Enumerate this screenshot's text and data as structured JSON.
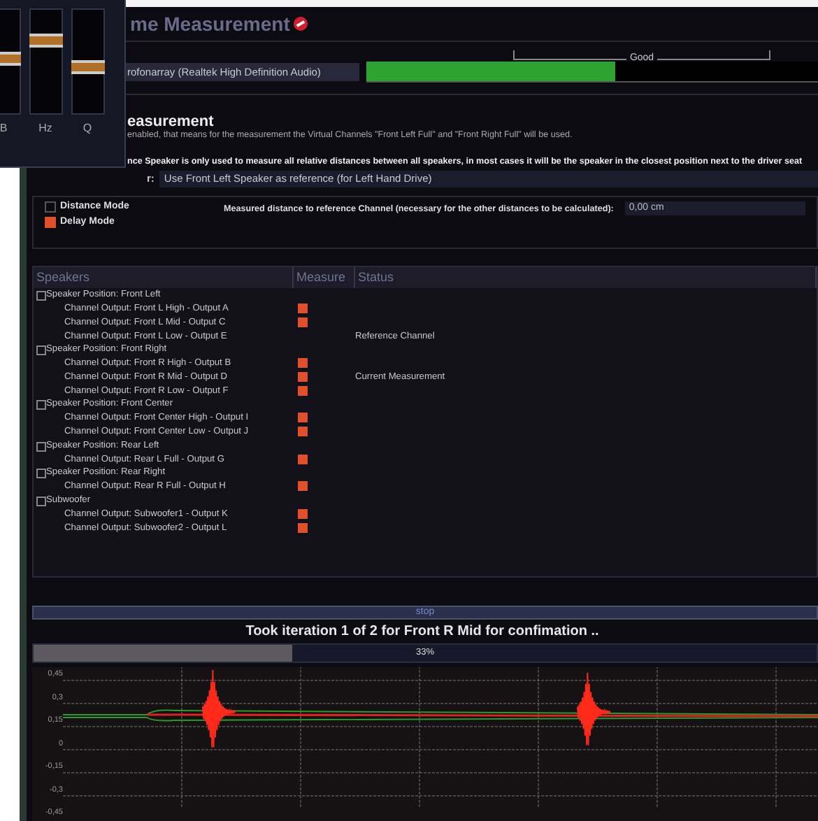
{
  "eq_panel": {
    "sliders": [
      {
        "label": "B",
        "level": 0.55
      },
      {
        "label": "Hz",
        "level": 0.75
      },
      {
        "label": "Q",
        "level": 0.45
      }
    ]
  },
  "window": {
    "title": "me Measurement"
  },
  "input_level": {
    "scale_label": "Good",
    "device": "rofonarray (Realtek High Definition Audio)",
    "level": 0.55
  },
  "section": {
    "heading": "easurement",
    "note": "enabled, that means for the measurement the Virtual Channels \"Front Left Full\" and \"Front Right Full\" will be used.",
    "reference_note": "nce Speaker is only used to measure all relative distances between all speakers, in most cases it will be the speaker in the closest position next to the driver seat",
    "reference_label": "r:",
    "reference_value": "Use Front Left Speaker as reference (for Left Hand Drive)"
  },
  "modes": [
    {
      "label": "Distance Mode",
      "checked": false
    },
    {
      "label": "Delay Mode",
      "checked": true
    }
  ],
  "distance": {
    "label": "Measured distance to reference Channel (necessary for the other distances to be calculated):",
    "value": "0,00 cm"
  },
  "table": {
    "columns": [
      "Speakers",
      "Measure",
      "Status"
    ],
    "groups": [
      {
        "label": "Speaker Position: Front Left",
        "expanded": true,
        "children": [
          {
            "label": "Channel Output: Front L High - Output A",
            "measure": true
          },
          {
            "label": "Channel Output: Front L Mid - Output C",
            "measure": true
          },
          {
            "label": "Channel Output: Front L Low - Output E",
            "measure": false,
            "status": "Reference Channel"
          }
        ]
      },
      {
        "label": "Speaker Position: Front Right",
        "expanded": true,
        "children": [
          {
            "label": "Channel Output: Front R High - Output B",
            "measure": true
          },
          {
            "label": "Channel Output: Front R Mid - Output D",
            "measure": true,
            "status": "Current Measurement"
          },
          {
            "label": "Channel Output: Front R Low - Output F",
            "measure": true
          }
        ]
      },
      {
        "label": "Speaker Position: Front Center",
        "expanded": true,
        "children": [
          {
            "label": "Channel Output: Front Center High - Output I",
            "measure": true
          },
          {
            "label": "Channel Output: Front Center Low - Output J",
            "measure": true
          }
        ]
      },
      {
        "label": "Speaker Position: Rear Left",
        "expanded": true,
        "children": [
          {
            "label": "Channel Output: Rear L Full - Output G",
            "measure": true
          }
        ]
      },
      {
        "label": "Speaker Position: Rear Right",
        "expanded": true,
        "children": [
          {
            "label": "Channel Output: Rear R Full - Output H",
            "measure": true
          }
        ]
      },
      {
        "label": "Subwoofer",
        "expanded": true,
        "children": [
          {
            "label": "Channel Output: Subwoofer1 - Output K",
            "measure": true
          },
          {
            "label": "Channel Output: Subwoofer2 - Output L",
            "measure": true
          }
        ]
      }
    ]
  },
  "stop_button": "stop",
  "progress": {
    "title": "Took iteration 1 of 2 for Front R Mid for confimation ..",
    "level": 0.33,
    "reading": "33%"
  },
  "waveform": {
    "y_labels": [
      "0,45",
      "0,3",
      "0,15",
      "0",
      "-0,15",
      "-0,3",
      "-0,45"
    ]
  }
}
